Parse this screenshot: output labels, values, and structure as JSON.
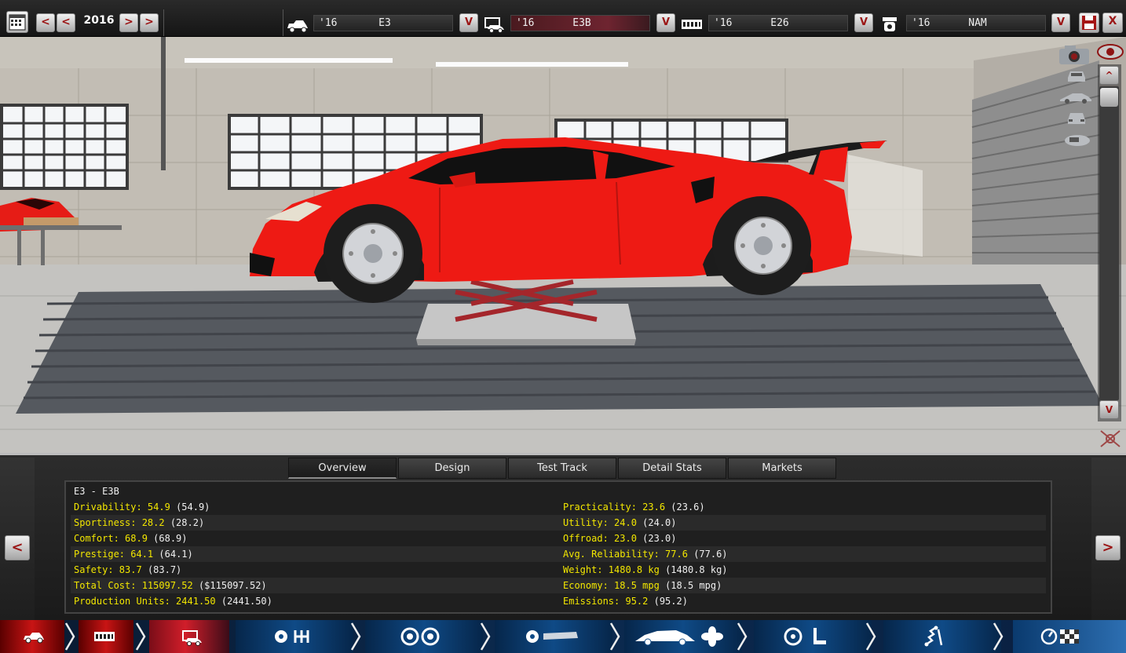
{
  "top_bar": {
    "year": "2016",
    "prev_fast_label": "<",
    "prev_label": "<",
    "next_label": ">",
    "next_fast_label": ">",
    "selectors": [
      {
        "icon": "chassis-icon",
        "year": "'16",
        "name": "E3",
        "dropdown_label": "V"
      },
      {
        "icon": "car-model-icon",
        "year": "'16",
        "name": "E3B",
        "dropdown_label": "V"
      },
      {
        "icon": "engine-icon",
        "year": "'16",
        "name": "E26",
        "dropdown_label": "V"
      },
      {
        "icon": "gearbox-icon",
        "year": "'16",
        "name": "NAM",
        "dropdown_label": "V"
      }
    ],
    "save_icon": "save-icon",
    "close_label": "X"
  },
  "scene": {
    "scroll_up_label": "^",
    "scroll_down_label": "V",
    "camera_views": [
      "camera-icon",
      "view-front-icon",
      "view-side-icon",
      "view-rear-icon",
      "view-top-icon"
    ],
    "eye_icon": "eye-icon",
    "axis_icon": "axis-icon",
    "colors": {
      "car_body": "#ee1a14"
    }
  },
  "tabs": [
    {
      "label": "Overview",
      "active": true
    },
    {
      "label": "Design",
      "active": false
    },
    {
      "label": "Test Track",
      "active": false
    },
    {
      "label": "Detail Stats",
      "active": false
    },
    {
      "label": "Markets",
      "active": false
    }
  ],
  "panel": {
    "prev_label": "<",
    "next_label": ">",
    "title": "E3 - E3B",
    "left_stats": [
      {
        "key": "Drivability: 54.9",
        "paren": "(54.9)"
      },
      {
        "key": "Sportiness: 28.2",
        "paren": "(28.2)"
      },
      {
        "key": "Comfort: 68.9",
        "paren": "(68.9)"
      },
      {
        "key": "Prestige: 64.1",
        "paren": "(64.1)"
      },
      {
        "key": "Safety: 83.7",
        "paren": "(83.7)"
      },
      {
        "key": "Total Cost: 115097.52",
        "paren": "($115097.52)"
      },
      {
        "key": "Production Units: 2441.50",
        "paren": "(2441.50)"
      }
    ],
    "right_stats": [
      {
        "key": "Practicality: 23.6",
        "paren": "(23.6)"
      },
      {
        "key": "Utility: 24.0",
        "paren": "(24.0)"
      },
      {
        "key": "Offroad: 23.0",
        "paren": "(23.0)"
      },
      {
        "key": "Avg. Reliability: 77.6",
        "paren": "(77.6)"
      },
      {
        "key": "Weight: 1480.8 kg",
        "paren": "(1480.8 kg)"
      },
      {
        "key": "Economy: 18.5 mpg",
        "paren": "(18.5 mpg)"
      },
      {
        "key": "Emissions: 95.2",
        "paren": "(95.2)"
      }
    ]
  },
  "step_bar": {
    "steps": [
      {
        "icon": "chassis-icon",
        "state": "done"
      },
      {
        "icon": "engine-icon",
        "state": "done"
      },
      {
        "icon": "car-model-icon",
        "state": "current"
      },
      {
        "icon": "gear-shift-icon",
        "state": "todo"
      },
      {
        "icon": "wheels-icon",
        "state": "todo"
      },
      {
        "icon": "body-cooling-icon",
        "state": "todo"
      },
      {
        "icon": "interior-icon",
        "state": "todo"
      },
      {
        "icon": "suspension-icon",
        "state": "todo"
      },
      {
        "icon": "test-finish-icon",
        "state": "todo"
      }
    ]
  }
}
